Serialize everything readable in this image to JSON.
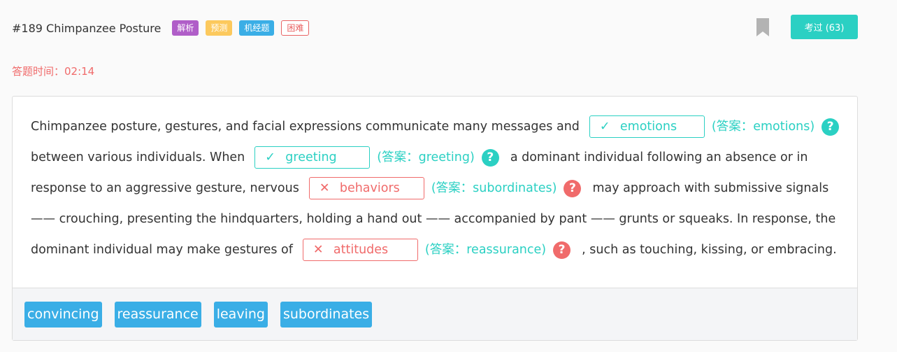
{
  "header": {
    "title": "#189 Chimpanzee Posture",
    "tags": [
      {
        "label": "解析",
        "color": "#b05ec8"
      },
      {
        "label": "预测",
        "color": "#fcc95d"
      },
      {
        "label": "机经题",
        "color": "#3aaee6"
      },
      {
        "label": "困难",
        "color": "#e96363"
      }
    ],
    "exam_button": "考过 (63)"
  },
  "timer": "答题时间：02:14",
  "passage": {
    "l1_text": "Chimpanzee posture, gestures, and facial expressions communicate many messages and",
    "b1_value": "emotions",
    "b1_answer": "(答案：emotions)",
    "l2_text": "between various individuals. When",
    "b2_value": "greeting",
    "b2_answer": "(答案：greeting)",
    "l2_after": "a dominant individual following an absence or in",
    "l3_text": "response to an aggressive gesture, nervous",
    "b3_value": "behaviors",
    "b3_answer": "(答案：subordinates)",
    "l3_after": "may approach with submissive signals",
    "l4_text": "—— crouching, presenting the hindquarters, holding a hand out —— accompanied by pant —— grunts or squeaks. In response, the",
    "l5_text": "dominant individual may make gestures of",
    "b4_value": "attitudes",
    "b4_answer": "(答案：reassurance)",
    "l5_after": ", such as touching, kissing, or embracing.",
    "check_mark": "✓",
    "cross_mark": "✕",
    "help_mark": "?"
  },
  "options": [
    "convincing",
    "reassurance",
    "leaving",
    "subordinates"
  ],
  "colors": {
    "correct": "#2bd0c3",
    "wrong": "#f06b6b",
    "chip": "#3aaee6"
  }
}
